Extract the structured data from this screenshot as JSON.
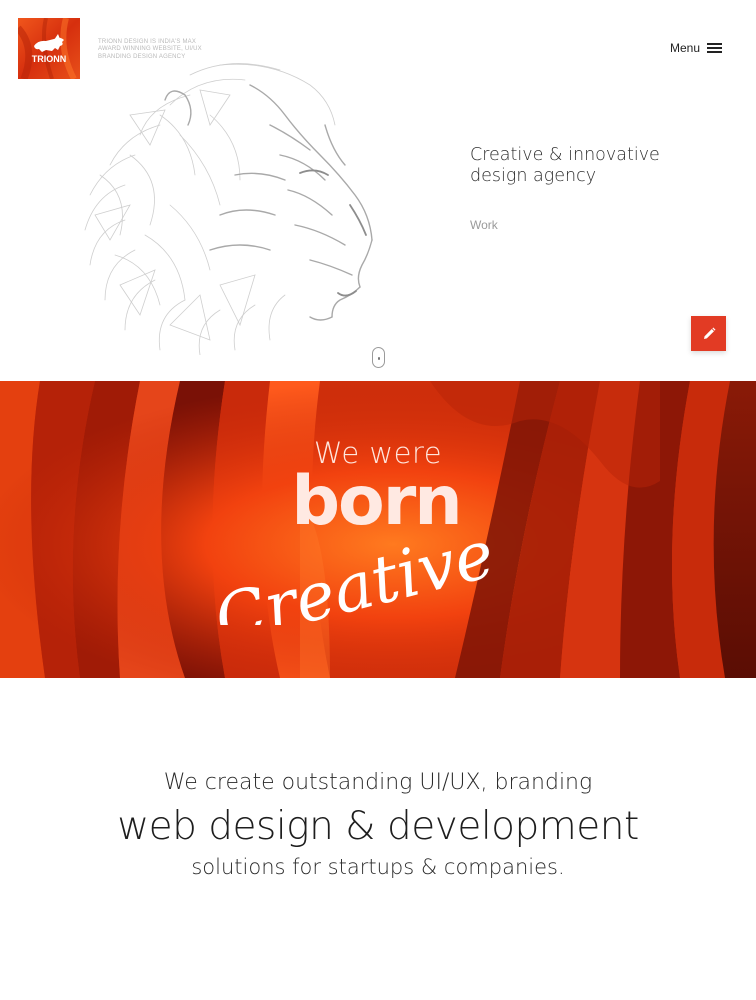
{
  "header": {
    "logo_text": "TRIONN",
    "tagline": "TRIONN DESIGN IS INDIA'S MAX AWARD WINNING WEBSITE, UI/UX BRANDING DESIGN AGENCY",
    "menu_label": "Menu",
    "menu_icon": "hamburger-icon"
  },
  "hero": {
    "headline_line1": "Creative & innovative",
    "headline_line2": "design agency",
    "work_link": "Work",
    "edit_icon": "pencil-icon",
    "scroll_icon": "mouse-scroll-icon",
    "illustration": "lion-sketch"
  },
  "banner": {
    "line1": "We were",
    "line2": "born",
    "line3": "Creative"
  },
  "intro": {
    "line1": "We create outstanding UI/UX, branding",
    "line2": "web design & development",
    "line3": "solutions for startups & companies."
  },
  "colors": {
    "accent": "#e23b24",
    "banner_dark": "#7a1206",
    "banner_light": "#ff6a1a"
  }
}
